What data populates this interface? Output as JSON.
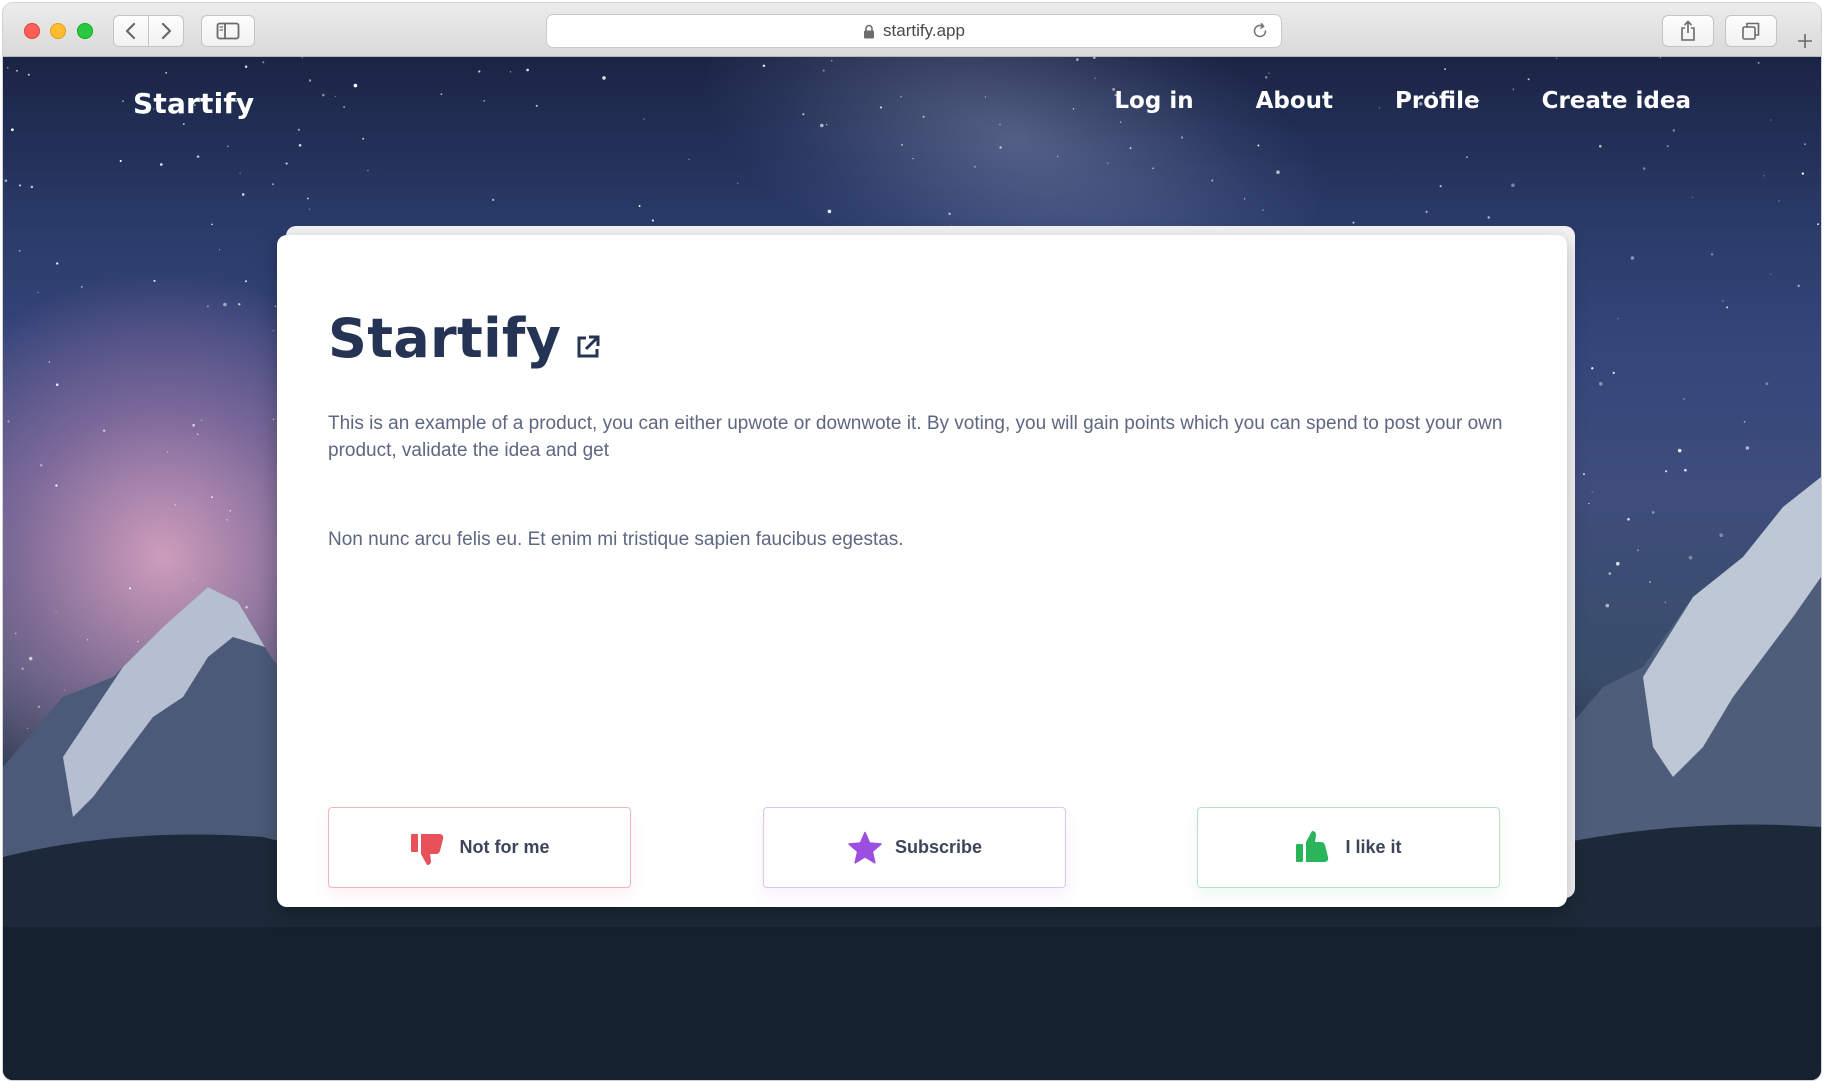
{
  "browser": {
    "url": "startify.app",
    "icons": {
      "back": "chevron-left-icon",
      "forward": "chevron-right-icon",
      "sidebar": "sidebar-icon",
      "lock": "lock-icon",
      "reload": "reload-icon",
      "share": "share-icon",
      "tabs": "tabs-icon",
      "new_tab": "plus-icon"
    }
  },
  "header": {
    "brand": "Startify",
    "nav": [
      "Log in",
      "About",
      "Profile",
      "Create idea"
    ]
  },
  "card": {
    "title": "Startify",
    "description": "This is an example of a product, you can either upwote or downwote it. By voting, you will gain points which you can spend to post your own product, validate the idea and get",
    "extra": "Non nunc arcu felis eu. Et enim mi tristique sapien faucibus egestas.",
    "buttons": {
      "downvote": "Not for me",
      "subscribe": "Subscribe",
      "upvote": "I like it"
    }
  },
  "colors": {
    "title": "#253454",
    "body_text": "#5e6781",
    "downvote": "#e8505a",
    "subscribe": "#9b4fe0",
    "upvote": "#2bb55b"
  }
}
